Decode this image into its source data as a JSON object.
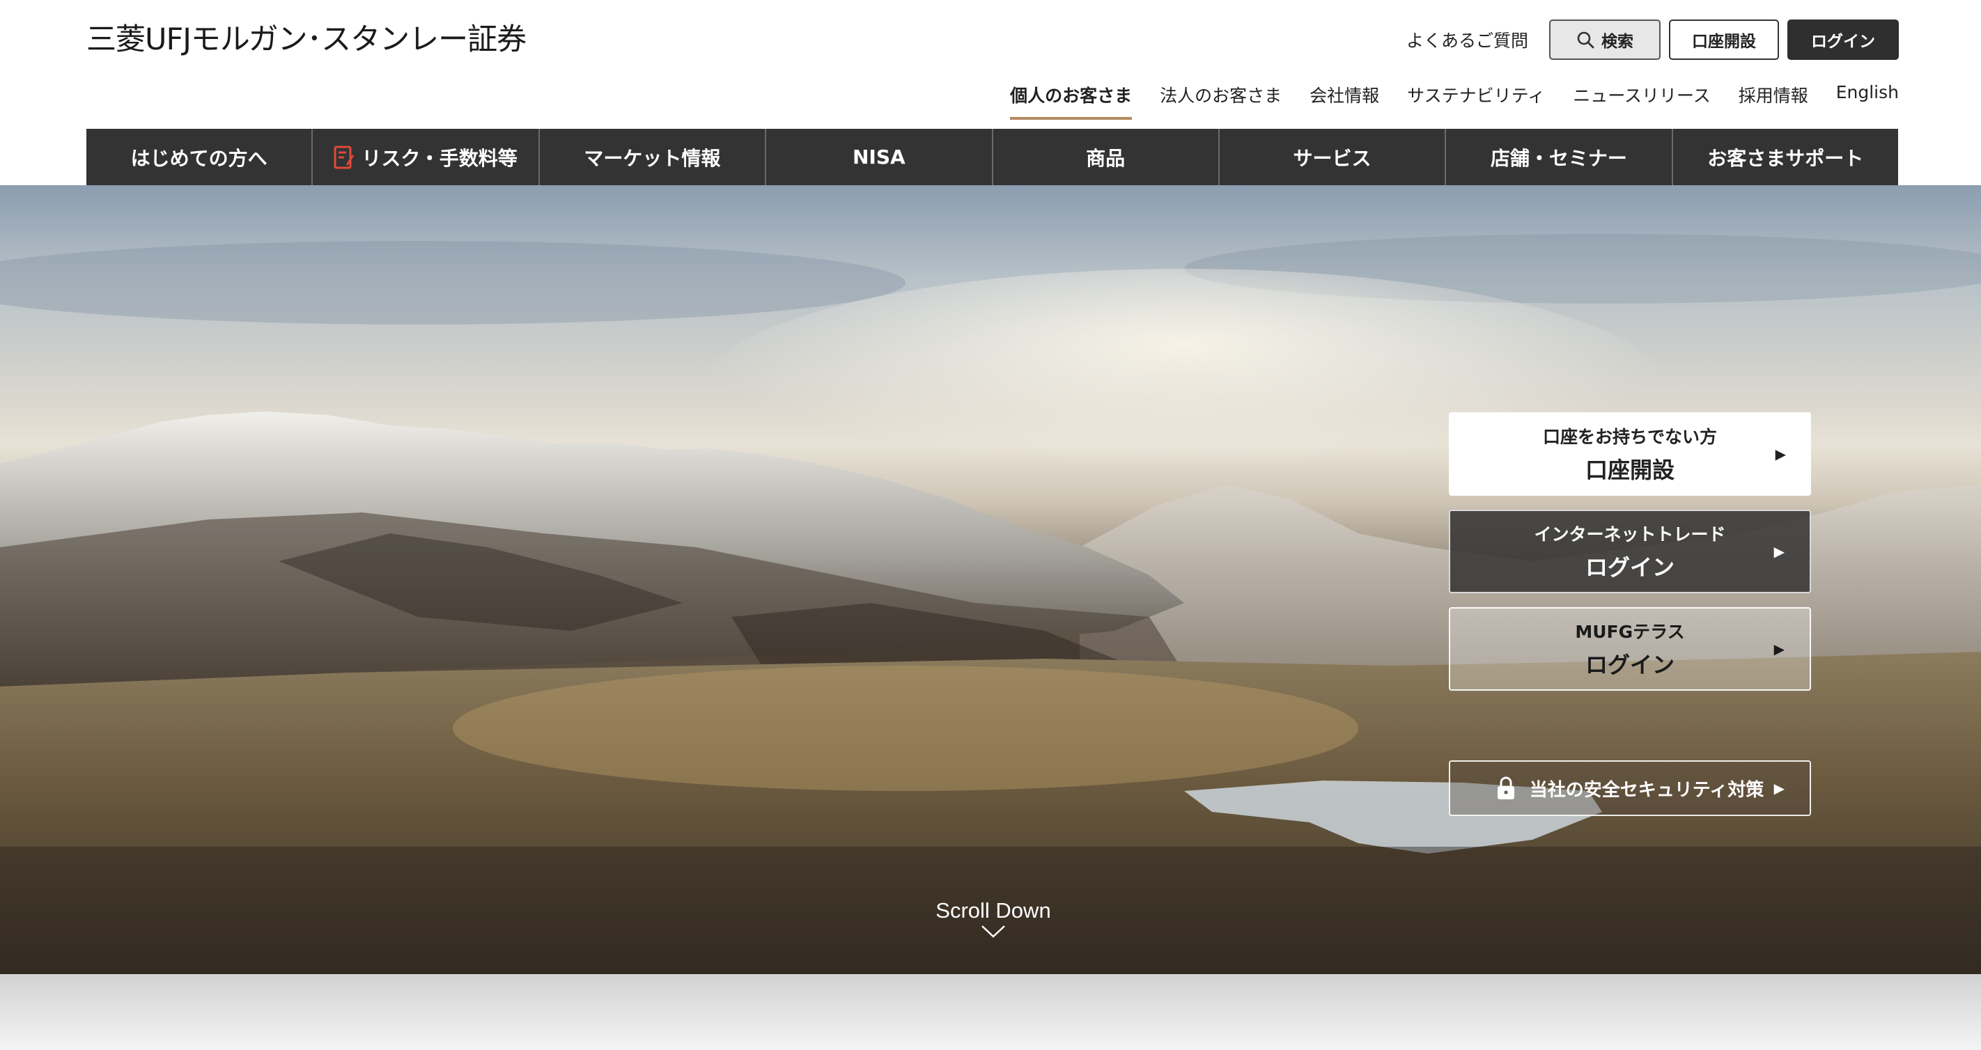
{
  "header": {
    "logo": "三菱UFJモルガン･スタンレー証券",
    "faq": "よくあるご質問",
    "search": "検索",
    "account_open": "口座開設",
    "login": "ログイン"
  },
  "segments": [
    "個人のお客さま",
    "法人のお客さま",
    "会社情報",
    "サステナビリティ",
    "ニュースリリース",
    "採用情報",
    "English"
  ],
  "main_nav": [
    "はじめての方へ",
    "リスク・手数料等",
    "マーケット情報",
    "NISA",
    "商品",
    "サービス",
    "店舗・セミナー",
    "お客さまサポート"
  ],
  "hero": {
    "cta_account": {
      "line1": "口座をお持ちでない方",
      "line2": "口座開設"
    },
    "cta_internet": {
      "line1": "インターネットトレード",
      "line2": "ログイン"
    },
    "cta_mufg": {
      "line1": "MUFGテラス",
      "line2": "ログイン"
    },
    "cta_security": "当社の安全セキュリティ対策",
    "scroll": "Scroll Down"
  },
  "colors": {
    "nav_bg": "#333333",
    "active_underline": "#b58a62",
    "login_bg": "#2f2f2f"
  },
  "icons": [
    "search-icon",
    "risk-document-icon",
    "play-arrow-icon",
    "lock-icon",
    "chevron-down-icon"
  ]
}
